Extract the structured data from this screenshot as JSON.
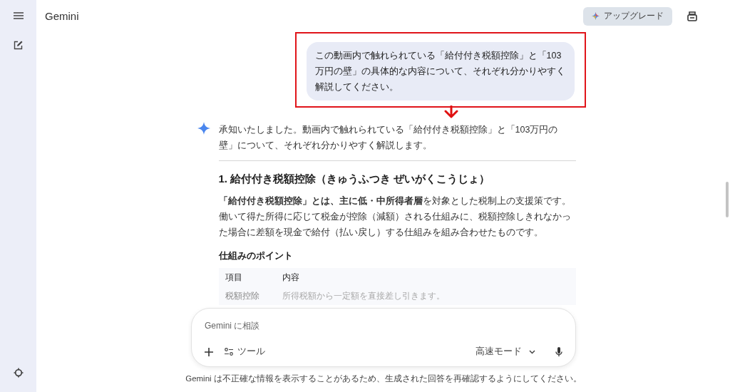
{
  "header": {
    "title": "Gemini",
    "upgrade_label": "アップグレード"
  },
  "user_message": {
    "text": "この動画内で触れられている「給付付き税額控除」と「103万円の壁」の具体的な内容について、それぞれ分かりやすく解説してください。",
    "highlighted": true
  },
  "response": {
    "intro": "承知いたしました。動画内で触れられている「給付付き税額控除」と「103万円の壁」について、それぞれ分かりやすく解説します。",
    "heading": "1. 給付付き税額控除（きゅうふつき ぜいがくこうじょ）",
    "paragraph": "**「給付付き税額控除」とは、主に低・中所得者層**を対象とした税制上の支援策です。働いて得た所得に応じて税金が控除（減額）される仕組みに、税額控除しきれなかった場合に差額を現金で給付（払い戻し）する仕組みを組み合わせたものです。",
    "subheading": "仕組みのポイント",
    "table": {
      "columns": [
        "項目",
        "内容"
      ],
      "rows": [
        [
          "税額控除",
          "所得税額から一定額を直接差し引きます。"
        ]
      ]
    }
  },
  "composer": {
    "placeholder": "Gemini に相談",
    "tools_label": "ツール",
    "mode": "高速モード"
  },
  "disclaimer": "Gemini は不正確な情報を表示することがあるため、生成された回答を再確認するようにしてください。"
}
